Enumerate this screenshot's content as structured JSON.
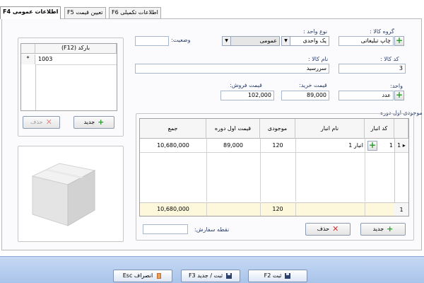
{
  "tabs": [
    {
      "label": "اطلاعات عمومی F4"
    },
    {
      "label": "تعیین قیمت F5"
    },
    {
      "label": "اطلاعات تکمیلی F6"
    }
  ],
  "form": {
    "group_label": "گروه کالا :",
    "group_value": "چاپ تبلیغاتی",
    "unit_type_label": "نوع واحد :",
    "unit_type_value": "یک واحدی",
    "kind_value": "عمومی",
    "status_label": "وضعیت:",
    "status_value": "",
    "code_label": "کد کالا :",
    "code_value": "3",
    "name_label": "نام کالا :",
    "name_value": "سررسید",
    "unit_label": "واحد:",
    "unit_value": "عدد",
    "buy_price_label": "قیمت خرید:",
    "buy_price_value": "89,000",
    "sell_price_label": "قیمت فروش:",
    "sell_price_value": "102,000"
  },
  "barcode": {
    "header": "(F12) بارکد",
    "rows": [
      {
        "marker": "*",
        "value": "1003"
      }
    ],
    "delete_label": "حذف",
    "new_label": "جدید"
  },
  "stock": {
    "title": "موجودی اول دوره",
    "columns": [
      "کد انبار",
      "نام انبار",
      "موجودی",
      "قیمت اول دوره",
      "جمع"
    ],
    "row": {
      "index": "1",
      "code": "1",
      "name": "انبار 1",
      "qty": "120",
      "price": "89,000",
      "total": "10,680,000"
    },
    "footer": {
      "index": "1",
      "qty": "120",
      "total": "10,680,000"
    },
    "order_point_label": "نقطه سفارش:",
    "order_point_value": "",
    "delete_label": "حذف",
    "new_label": "جدید"
  },
  "footer_buttons": {
    "cancel": "انصراف Esc",
    "save_new": "ثبت / جدید F3",
    "save": "ثبت F2"
  },
  "colors": {
    "accent": "#2a9d2a",
    "danger": "#d03030",
    "footer_row": "#fdf8dc",
    "bottom_bar": "#b4cbee"
  },
  "icons": {
    "plus": "plus-icon",
    "delete": "x-icon",
    "box": "box-image",
    "disk": "floppy-disk-icon",
    "exit": "door-icon"
  }
}
